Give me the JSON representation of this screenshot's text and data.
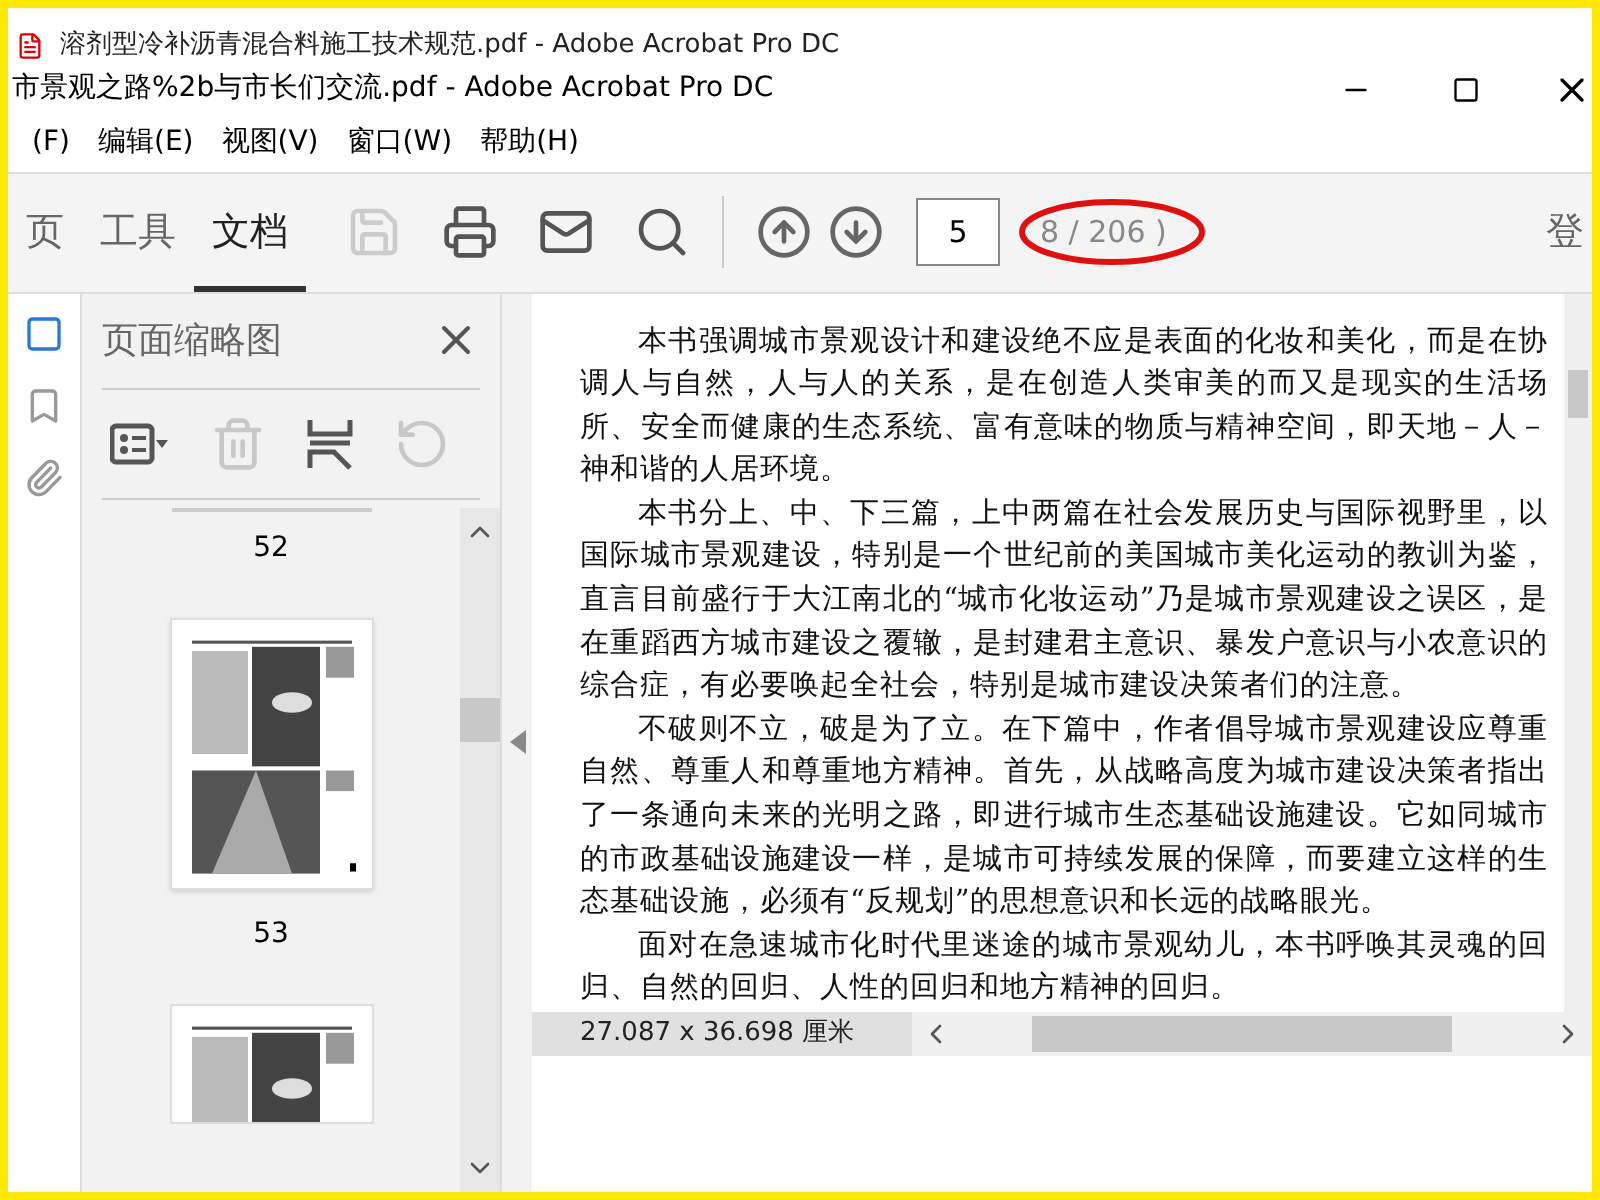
{
  "background_window": {
    "title": "溶剂型冷补沥青混合料施工技术规范.pdf - Adobe Acrobat Pro DC"
  },
  "window": {
    "title": "市景观之路%2b与市长们交流.pdf - Adobe Acrobat Pro DC"
  },
  "menu": [
    "(F)",
    "编辑(E)",
    "视图(V)",
    "窗口(W)",
    "帮助(H)"
  ],
  "tabs": [
    {
      "label": "页",
      "selected": false
    },
    {
      "label": "工具",
      "selected": false
    },
    {
      "label": "文档",
      "selected": true
    }
  ],
  "tools": [
    {
      "kind": "save",
      "disabled": true
    },
    {
      "kind": "print",
      "disabled": false
    },
    {
      "kind": "mail",
      "disabled": false
    },
    {
      "kind": "search",
      "disabled": false
    }
  ],
  "page_field": {
    "value": "5"
  },
  "page_count": "8 / 206 )",
  "sign_in": "登",
  "thumbnail_panel": {
    "title": "页面缩略图",
    "tools": [
      {
        "kind": "options",
        "disabled": false
      },
      {
        "kind": "delete",
        "disabled": true
      },
      {
        "kind": "insert",
        "disabled": false
      },
      {
        "kind": "rotate",
        "disabled": true
      }
    ],
    "pages": [
      {
        "label": "52"
      },
      {
        "label": "53"
      }
    ]
  },
  "document": {
    "paragraphs": [
      "本书强调城市景观设计和建设绝不应是表面的化妆和美化，而是在协调人与自然，人与人的关系，是在创造人类审美的而又是现实的生活场所、安全而健康的生态系统、富有意味的物质与精神空间，即天地－人－神和谐的人居环境。",
      "本书分上、中、下三篇，上中两篇在社会发展历史与国际视野里，以国际城市景观建设，特别是一个世纪前的美国城市美化运动的教训为鉴，直言目前盛行于大江南北的“城市化妆运动”乃是城市景观建设之误区，是在重蹈西方城市建设之覆辙，是封建君主意识、暴发户意识与小农意识的综合症，有必要唤起全社会，特别是城市建设决策者们的注意。",
      "不破则不立，破是为了立。在下篇中，作者倡导城市景观建设应尊重自然、尊重人和尊重地方精神。首先，从战略高度为城市建设决策者指出了一条通向未来的光明之路，即进行城市生态基础设施建设。它如同城市的市政基础设施建设一样，是城市可持续发展的保障，而要建立这样的生态基础设施，必须有“反规划”的思想意识和长远的战略眼光。",
      "面对在急速城市化时代里迷途的城市景观幼儿，本书呼唤其灵魂的回归、自然的回归、人性的回归和地方精神的回归。"
    ]
  },
  "status": {
    "page_size": "27.087 x 36.698 厘米"
  }
}
